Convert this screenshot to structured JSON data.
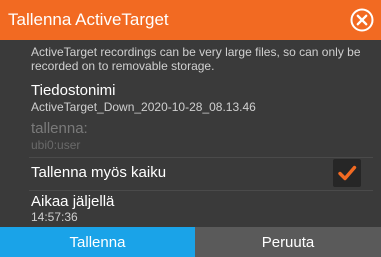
{
  "dialog": {
    "title": "Tallenna ActiveTarget",
    "close_icon": "close-circle-icon",
    "accent_color": "#f26a22",
    "info": "ActiveTarget recordings can be very large files, so can only be recorded on to removable storage."
  },
  "filename": {
    "label": "Tiedostonimi",
    "value": "ActiveTarget_Down_2020-10-28_08.13.46"
  },
  "save_location": {
    "label": "tallenna:",
    "value": "ubi0:user"
  },
  "save_sonar": {
    "label": "Tallenna myös kaiku",
    "checked": true,
    "check_icon": "checkmark-icon"
  },
  "time_left": {
    "label": "Aikaa jäljellä",
    "value": "14:57:36"
  },
  "buttons": {
    "save_label": "Tallenna",
    "cancel_label": "Peruuta",
    "save_color": "#1aa3e8"
  }
}
